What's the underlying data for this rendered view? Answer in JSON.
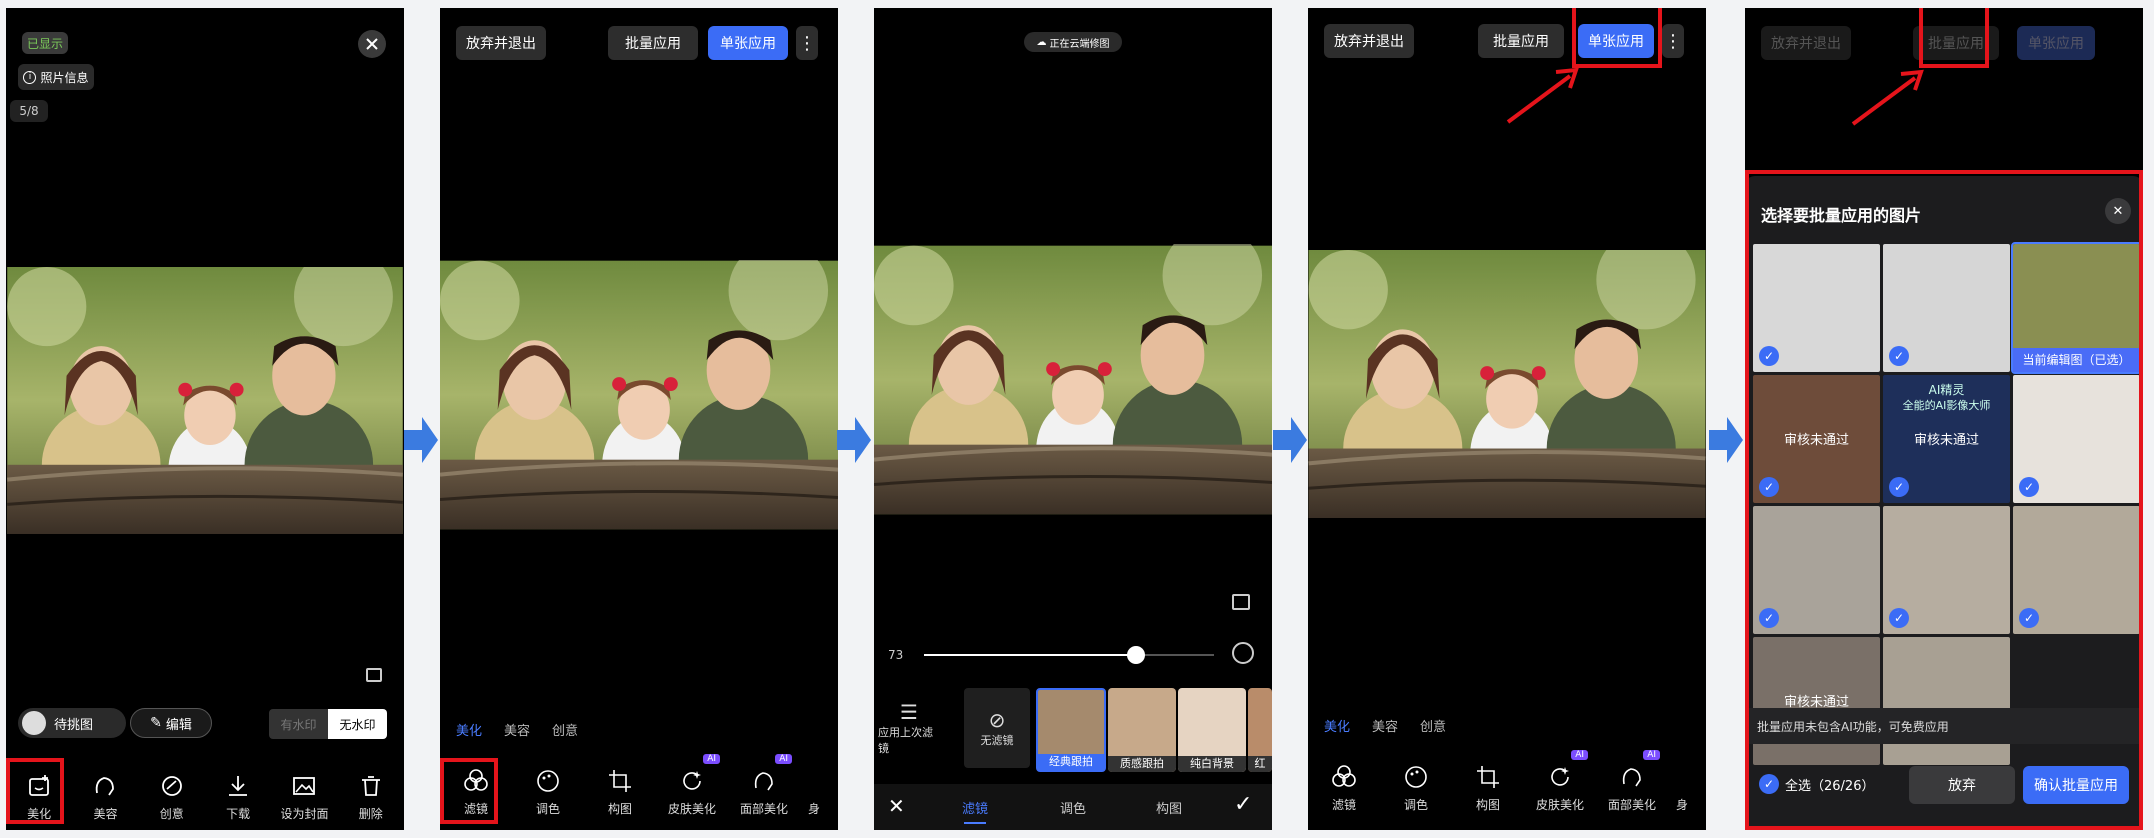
{
  "screen1": {
    "shown_badge": "已显示",
    "photo_info": "照片信息",
    "counter": "5/8",
    "pending_label": "待挑图",
    "edit_label": "编辑",
    "watermark_on": "有水印",
    "watermark_off": "无水印",
    "tools": [
      "美化",
      "美容",
      "创意",
      "下载",
      "设为封面",
      "删除"
    ]
  },
  "screen2": {
    "discard": "放弃并退出",
    "batch": "批量应用",
    "single": "单张应用",
    "tabs": [
      "美化",
      "美容",
      "创意"
    ],
    "tools": [
      "滤镜",
      "调色",
      "构图",
      "皮肤美化",
      "面部美化",
      "身"
    ],
    "ai_badge": "AI"
  },
  "screen3": {
    "cloud_status": "正在云端修图",
    "slider_value": "73",
    "slider_fraction": 0.73,
    "apply_last": "应用上次滤镜",
    "no_filter": "无滤镜",
    "filters": [
      "经典跟拍",
      "质感跟拍",
      "纯白背景",
      "红"
    ],
    "tabs": [
      "滤镜",
      "调色",
      "构图"
    ]
  },
  "screen4": {
    "discard": "放弃并退出",
    "batch": "批量应用",
    "single": "单张应用",
    "tabs": [
      "美化",
      "美容",
      "创意"
    ],
    "tools": [
      "滤镜",
      "调色",
      "构图",
      "皮肤美化",
      "面部美化",
      "身"
    ],
    "ai_badge": "AI"
  },
  "screen5": {
    "discard": "放弃并退出",
    "batch": "批量应用",
    "single": "单张应用",
    "sheet_title": "选择要批量应用的图片",
    "review_failed": "审核未通过",
    "current_label": "当前编辑图（已选）",
    "ai_banner_line1": "AI精灵",
    "ai_banner_line2": "全能的AI影像大师",
    "notice": "批量应用未包含AI功能，可免费应用",
    "select_all": "全选（26/26）",
    "abandon": "放弃",
    "confirm": "确认批量应用"
  },
  "colors": {
    "accent": "#3b6cf6",
    "highlight": "#e5141b",
    "arrow": "#3b7be0",
    "ai": "#7b4dff"
  }
}
